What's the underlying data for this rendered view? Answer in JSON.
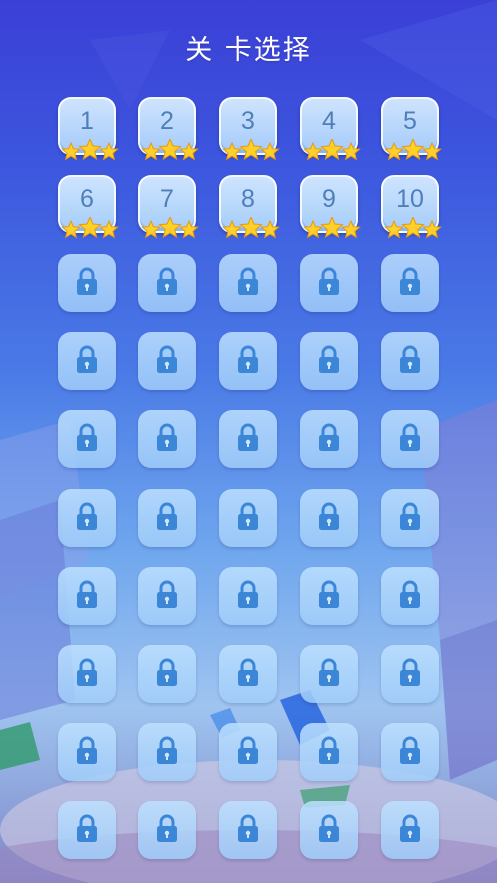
{
  "title": "关 卡选择",
  "levels": [
    {
      "label": "1",
      "locked": false,
      "stars": 3
    },
    {
      "label": "2",
      "locked": false,
      "stars": 3
    },
    {
      "label": "3",
      "locked": false,
      "stars": 3
    },
    {
      "label": "4",
      "locked": false,
      "stars": 3
    },
    {
      "label": "5",
      "locked": false,
      "stars": 3
    },
    {
      "label": "6",
      "locked": false,
      "stars": 3
    },
    {
      "label": "7",
      "locked": false,
      "stars": 3
    },
    {
      "label": "8",
      "locked": false,
      "stars": 3
    },
    {
      "label": "9",
      "locked": false,
      "stars": 3
    },
    {
      "label": "10",
      "locked": false,
      "stars": 3
    }
  ],
  "locked_tiles": 40,
  "columns": 5,
  "icons": {
    "star": "star-icon",
    "lock": "lock-icon"
  },
  "colors": {
    "star": "#ffd02a",
    "lock": "#3c86d8",
    "number": "#4f7fb8"
  }
}
